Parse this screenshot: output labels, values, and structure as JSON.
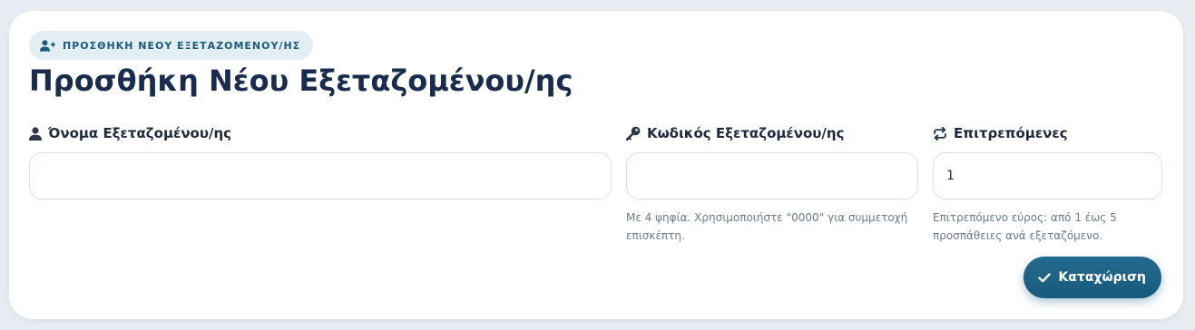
{
  "colors": {
    "page_background": "#e6ecf1",
    "card_background": "#ffffff",
    "badge_background": "#e3edf4",
    "badge_text": "#1c5b7a",
    "title": "#1a2c4e",
    "label": "#1d2a3d",
    "hint": "#6b7a8c",
    "input_border": "#d8e0e8",
    "primary_button": "#1c5f82"
  },
  "header": {
    "badge": {
      "icon": "user-plus-icon",
      "text": "ΠΡΟΣΘΗΚΗ ΝΕΟΥ ΕΞΕΤΑΖΟΜΕΝΟΥ/ΗΣ"
    },
    "title": "Προσθήκη Νέου Εξεταζομένου/ης"
  },
  "form": {
    "name": {
      "icon": "user-icon",
      "label": "Όνομα Εξεταζομένου/ης",
      "value": "",
      "placeholder": ""
    },
    "code": {
      "icon": "key-icon",
      "label": "Κωδικός Εξεταζομένου/ης",
      "value": "",
      "placeholder": "",
      "hint": "Με 4 ψηφία. Χρησιμοποιήστε \"0000\" για συμμετοχή επισκέπτη."
    },
    "attempts": {
      "icon": "repeat-icon",
      "label": "Επιτρεπόμενες",
      "value": "1",
      "hint": "Επιτρεπόμενο εύρος: από 1 έως 5 προσπάθειες ανά εξεταζόμενο."
    },
    "submit": {
      "icon": "check-icon",
      "label": "Καταχώριση"
    }
  }
}
